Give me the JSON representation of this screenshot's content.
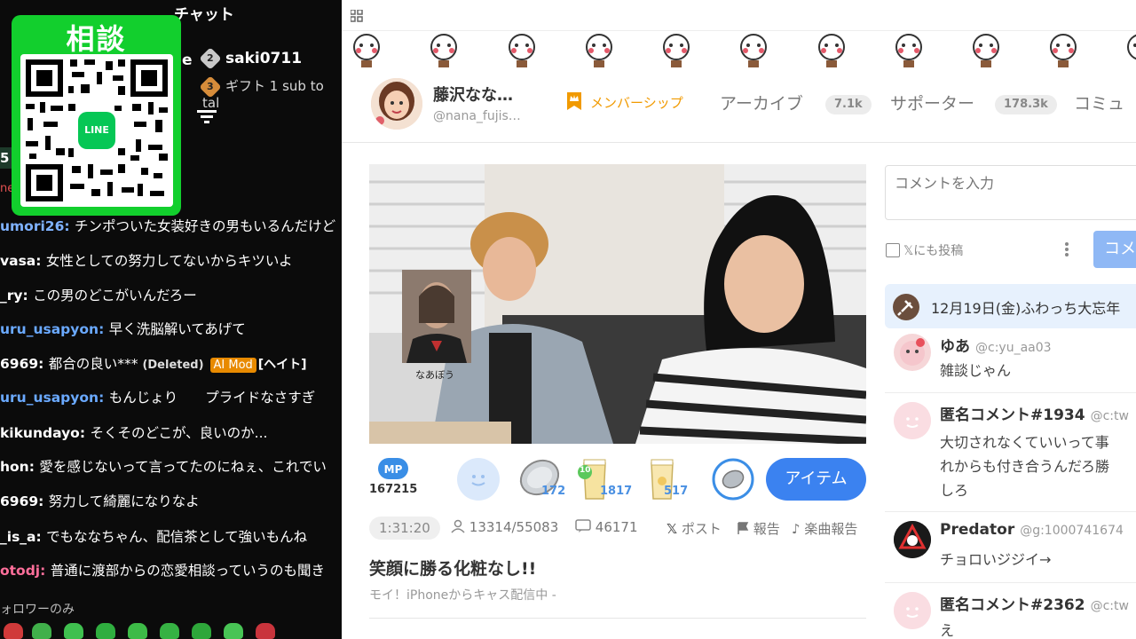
{
  "chat": {
    "title": "チャット",
    "qr_card_title": "相談",
    "line_badge": "LINE",
    "top_gifters": [
      {
        "rank": "2",
        "name": "saki0711"
      },
      {
        "rank": "3",
        "name": "ギフト 1 sub to tal"
      }
    ],
    "partial_left_char": "e",
    "left_stub_number": "5",
    "left_stub_text": "ne",
    "messages": [
      {
        "user": "umori26",
        "text": "チンポついた女装好きの男もいるんだけど",
        "user_color": "#7fb2ff"
      },
      {
        "user": "vasa",
        "text": "女性としての努力してないからキツいよ",
        "user_color": "#ffffff"
      },
      {
        "user": "_ry",
        "text": "この男のどこがいんだろー",
        "user_color": "#ffffff"
      },
      {
        "user": "uru_usapyon",
        "text": "早く洗脳解いてあげて",
        "user_color": "#6aa9ff"
      },
      {
        "user": "6969",
        "text": "都合の良い***",
        "deleted": "(Deleted)",
        "badge": "AI Mod",
        "ban": "[ヘイト]",
        "user_color": "#ffffff"
      },
      {
        "user": "uru_usapyon",
        "text": "もんじょり　　プライドなさすぎ",
        "user_color": "#6aa9ff"
      },
      {
        "user": "kikundayo",
        "text": "そくそのどこが、良いのか...",
        "user_color": "#ffffff"
      },
      {
        "user": "hon",
        "text": "愛を感じないって言ってたのにねぇ、これでい",
        "user_color": "#ffffff"
      },
      {
        "user": "6969",
        "text": "努力して綺麗になりなよ",
        "user_color": "#ffffff"
      },
      {
        "user": "_is_a",
        "text": "でもななちゃん、配信茶として強いもんね",
        "user_color": "#ffffff"
      },
      {
        "user": "otodj",
        "text": "普通に渡部からの恋愛相談っていうのも聞き",
        "user_color": "#ff6f9b"
      }
    ],
    "follower_only": "ォロワーのみ"
  },
  "channel": {
    "name": "藤沢なな…",
    "handle": "@nana_fujis…",
    "tabs": {
      "membership": "メンバーシップ",
      "archive": "アーカイブ",
      "archive_count": "7.1k",
      "supporter": "サポーター",
      "supporter_count": "178.3k",
      "community": "コミュ"
    }
  },
  "video": {
    "pip_caption": "なあぼう"
  },
  "gifts": {
    "mp_label": "MP",
    "mp_value": "167215",
    "coin_count": "172",
    "tea_level": "10",
    "tea_count": "1817",
    "drink_count": "517",
    "item_button": "アイテム"
  },
  "stats": {
    "duration": "1:31:20",
    "viewers": "13314/55083",
    "comments": "46171",
    "post": "ポスト",
    "report": "報告",
    "music_report": "楽曲報告"
  },
  "live": {
    "title": "笑顔に勝る化粧なし!!",
    "subtitle": "モイ！iPhoneからキャス配信中 -"
  },
  "comments_panel": {
    "input_placeholder": "コメントを入力",
    "x_post_label": "𝕏にも投稿",
    "submit_label": "コメ",
    "pinned": "12月19日(金)ふわっち大忘年",
    "items": [
      {
        "name": "ゆあ",
        "id": "@c:yu_aa03",
        "lines": [
          "雑談じゃん"
        ]
      },
      {
        "name": "匿名コメント#1934",
        "id": "@c:tw",
        "lines": [
          "大切されなくていいって事",
          "れからも付き合うんだろ勝",
          "しろ"
        ]
      },
      {
        "name": "Predator",
        "id": "@g:1000741674",
        "lines": [
          "チョロいジジイ→"
        ]
      },
      {
        "name": "匿名コメント#2362",
        "id": "@c:tw",
        "lines": [
          "え"
        ]
      }
    ]
  }
}
